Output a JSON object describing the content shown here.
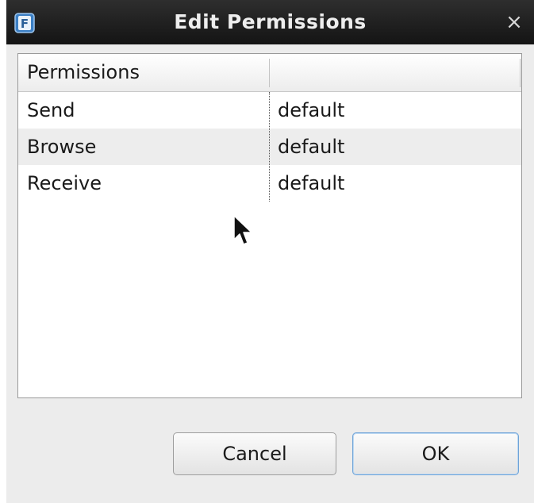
{
  "window": {
    "title": "Edit Permissions",
    "close_label": "×",
    "app_icon_letter": "F"
  },
  "table": {
    "headers": [
      "Permissions",
      ""
    ],
    "rows": [
      {
        "name": "Send",
        "value": "default"
      },
      {
        "name": "Browse",
        "value": "default"
      },
      {
        "name": "Receive",
        "value": "default"
      }
    ]
  },
  "buttons": {
    "cancel": "Cancel",
    "ok": "OK"
  },
  "colors": {
    "titlebar": "#1e1e1e",
    "dialog_bg": "#ececec",
    "alt_row": "#ededed",
    "focus_border": "#6fa3d8"
  },
  "icons": {
    "app": "app-logo-icon",
    "close": "close-icon",
    "cursor": "mouse-pointer-icon"
  }
}
